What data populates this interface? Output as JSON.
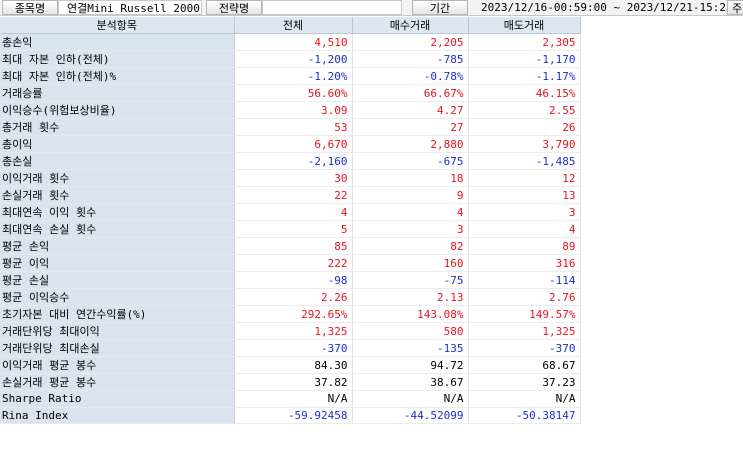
{
  "header": {
    "item_label": "종목명",
    "item_value": "연결Mini Russell 2000",
    "strategy_label": "전략명",
    "strategy_value": "",
    "period_label": "기간",
    "period_value": "2023/12/16-00:59:00 ~ 2023/12/21-15:25:00",
    "cut_button": "주"
  },
  "table": {
    "columns": [
      "분석항목",
      "전체",
      "매수거래",
      "매도거래"
    ],
    "rows": [
      {
        "label": "총손익",
        "values": [
          "4,510",
          "2,205",
          "2,305"
        ],
        "color": [
          "pos",
          "pos",
          "pos"
        ]
      },
      {
        "label": "최대 자본 인하(전체)",
        "values": [
          "-1,200",
          "-785",
          "-1,170"
        ],
        "color": [
          "neg",
          "neg",
          "neg"
        ]
      },
      {
        "label": "최대 자본 인하(전체)%",
        "values": [
          "-1.20%",
          "-0.78%",
          "-1.17%"
        ],
        "color": [
          "neg",
          "neg",
          "neg"
        ]
      },
      {
        "label": "거래승률",
        "values": [
          "56.60%",
          "66.67%",
          "46.15%"
        ],
        "color": [
          "pos",
          "pos",
          "pos"
        ]
      },
      {
        "label": "이익승수(위험보상비율)",
        "values": [
          "3.09",
          "4.27",
          "2.55"
        ],
        "color": [
          "pos",
          "pos",
          "pos"
        ]
      },
      {
        "label": "총거래 횟수",
        "values": [
          "53",
          "27",
          "26"
        ],
        "color": [
          "pos",
          "pos",
          "pos"
        ]
      },
      {
        "label": "총이익",
        "values": [
          "6,670",
          "2,880",
          "3,790"
        ],
        "color": [
          "pos",
          "pos",
          "pos"
        ]
      },
      {
        "label": "총손실",
        "values": [
          "-2,160",
          "-675",
          "-1,485"
        ],
        "color": [
          "neg",
          "neg",
          "neg"
        ]
      },
      {
        "label": "이익거래 횟수",
        "values": [
          "30",
          "18",
          "12"
        ],
        "color": [
          "pos",
          "pos",
          "pos"
        ]
      },
      {
        "label": "손실거래 횟수",
        "values": [
          "22",
          "9",
          "13"
        ],
        "color": [
          "pos",
          "pos",
          "pos"
        ]
      },
      {
        "label": "최대연속 이익 횟수",
        "values": [
          "4",
          "4",
          "3"
        ],
        "color": [
          "pos",
          "pos",
          "pos"
        ]
      },
      {
        "label": "최대연속 손실 횟수",
        "values": [
          "5",
          "3",
          "4"
        ],
        "color": [
          "pos",
          "pos",
          "pos"
        ]
      },
      {
        "label": "평균 손익",
        "values": [
          "85",
          "82",
          "89"
        ],
        "color": [
          "pos",
          "pos",
          "pos"
        ]
      },
      {
        "label": "평균 이익",
        "values": [
          "222",
          "160",
          "316"
        ],
        "color": [
          "pos",
          "pos",
          "pos"
        ]
      },
      {
        "label": "평균 손실",
        "values": [
          "-98",
          "-75",
          "-114"
        ],
        "color": [
          "neg",
          "neg",
          "neg"
        ]
      },
      {
        "label": "평균 이익승수",
        "values": [
          "2.26",
          "2.13",
          "2.76"
        ],
        "color": [
          "pos",
          "pos",
          "pos"
        ]
      },
      {
        "label": "초기자본 대비 연간수익률(%)",
        "values": [
          "292.65%",
          "143.08%",
          "149.57%"
        ],
        "color": [
          "pos",
          "pos",
          "pos"
        ]
      },
      {
        "label": "거래단위당 최대이익",
        "values": [
          "1,325",
          "580",
          "1,325"
        ],
        "color": [
          "pos",
          "pos",
          "pos"
        ]
      },
      {
        "label": "거래단위당 최대손실",
        "values": [
          "-370",
          "-135",
          "-370"
        ],
        "color": [
          "neg",
          "neg",
          "neg"
        ]
      },
      {
        "label": "이익거래 평균 봉수",
        "values": [
          "84.30",
          "94.72",
          "68.67"
        ],
        "color": [
          "plain",
          "plain",
          "plain"
        ]
      },
      {
        "label": "손실거래 평균 봉수",
        "values": [
          "37.82",
          "38.67",
          "37.23"
        ],
        "color": [
          "plain",
          "plain",
          "plain"
        ]
      },
      {
        "label": "Sharpe Ratio",
        "values": [
          "N/A",
          "N/A",
          "N/A"
        ],
        "color": [
          "plain",
          "plain",
          "plain"
        ]
      },
      {
        "label": "Rina Index",
        "values": [
          "-59.92458",
          "-44.52099",
          "-50.38147"
        ],
        "color": [
          "neg",
          "neg",
          "neg"
        ]
      }
    ]
  },
  "colors": {
    "positive": "#e8141e",
    "negative": "#1c2fd0",
    "header_bg": "#dde7f2",
    "label_bg": "#d9e4ef"
  }
}
